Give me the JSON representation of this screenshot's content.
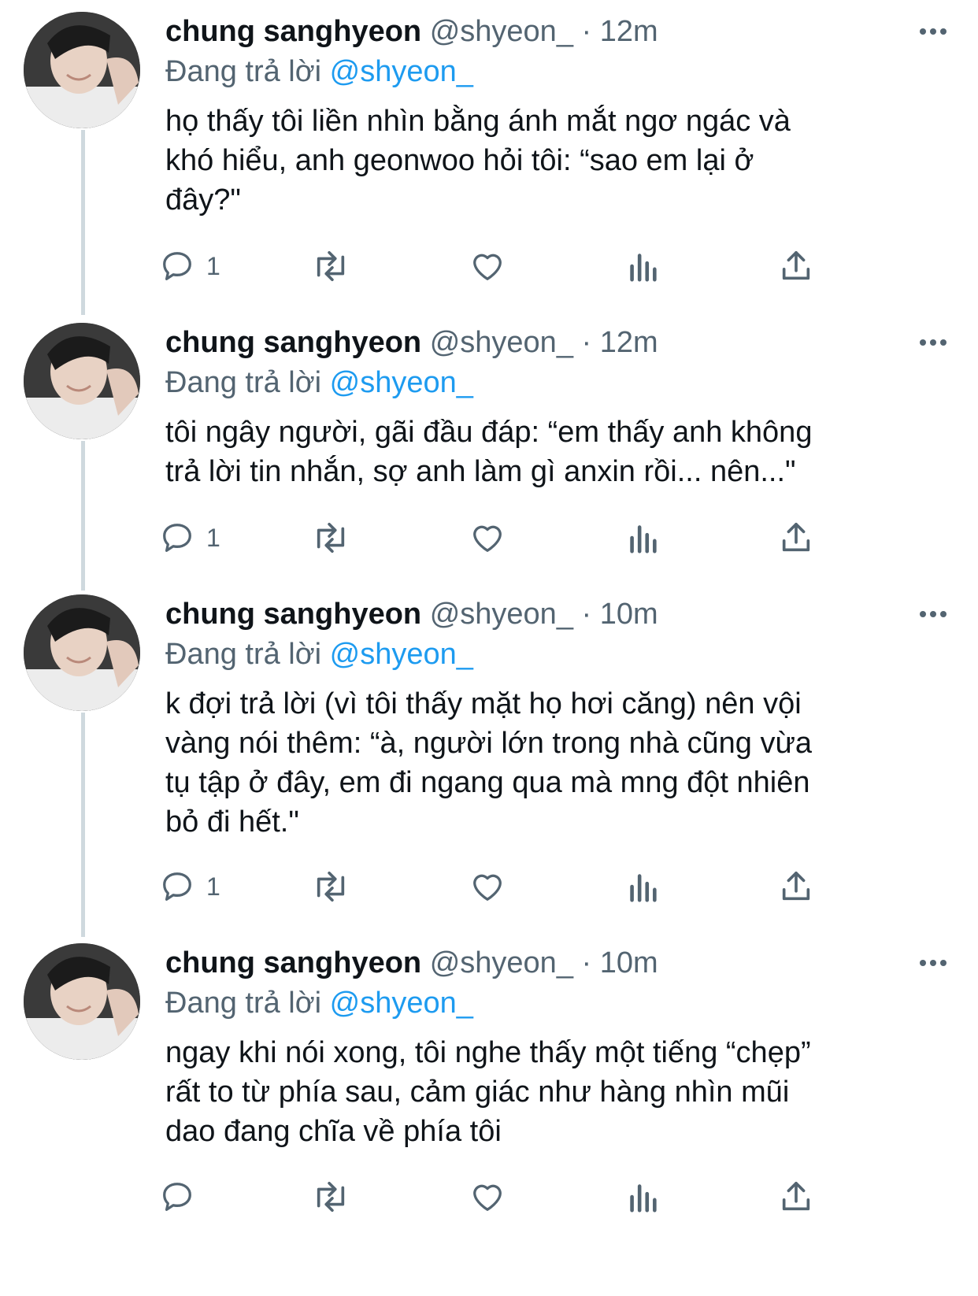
{
  "tweets": [
    {
      "name": "chung sanghyeon",
      "handle": "@shyeon_",
      "separator": "·",
      "time": "12m",
      "reply_prefix": "Đang trả lời",
      "reply_mention": "@shyeon_",
      "text": "họ thấy tôi liền nhìn bằng ánh mắt ngơ ngác và\nkhó hiểu, anh geonwoo hỏi tôi: “sao em lại ở\nđây?\"",
      "reply_count": "1"
    },
    {
      "name": "chung sanghyeon",
      "handle": "@shyeon_",
      "separator": "·",
      "time": "12m",
      "reply_prefix": "Đang trả lời",
      "reply_mention": "@shyeon_",
      "text": "tôi ngây người, gãi đầu đáp: “em thấy anh không\ntrả lời tin nhắn, sợ anh làm gì anxin rồi... nên...\"",
      "reply_count": "1"
    },
    {
      "name": "chung sanghyeon",
      "handle": "@shyeon_",
      "separator": "·",
      "time": "10m",
      "reply_prefix": "Đang trả lời",
      "reply_mention": "@shyeon_",
      "text": "k đợi trả lời (vì tôi thấy mặt họ hơi căng) nên vội\nvàng nói thêm: “à, người lớn trong nhà cũng vừa\ntụ tập ở đây, em đi ngang qua mà mng đột nhiên\nbỏ đi hết.\"",
      "reply_count": "1"
    },
    {
      "name": "chung sanghyeon",
      "handle": "@shyeon_",
      "separator": "·",
      "time": "10m",
      "reply_prefix": "Đang trả lời",
      "reply_mention": "@shyeon_",
      "text": "ngay khi nói xong, tôi nghe thấy một tiếng “chẹp”\nrất to từ phía sau, cảm giác như hàng nhìn mũi\ndao đang chĩa về phía tôi",
      "reply_count": ""
    }
  ],
  "icons": {
    "reply": "reply-icon",
    "retweet": "retweet-icon",
    "like": "heart-icon",
    "views": "views-icon",
    "share": "share-icon",
    "more": "more-icon"
  },
  "colors": {
    "text": "#0f1419",
    "secondary": "#536471",
    "mention": "#1d9bf0",
    "thread_line": "#cfd9de"
  }
}
